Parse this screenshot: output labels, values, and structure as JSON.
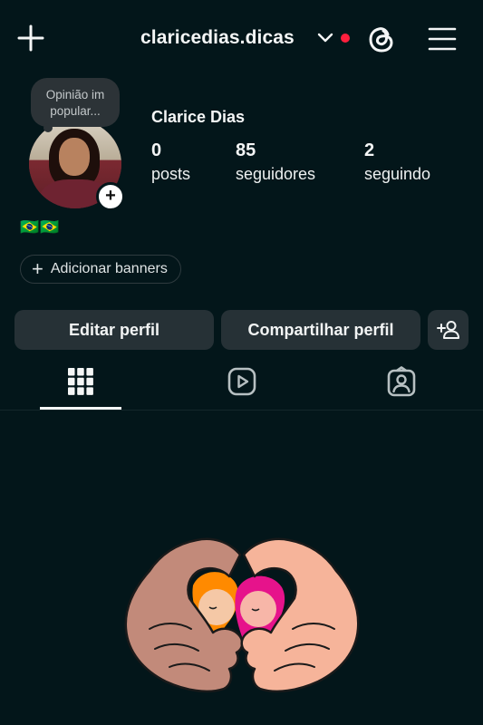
{
  "header": {
    "username": "claricedias.dicas",
    "icons": {
      "create": "plus-icon",
      "switch": "chevron-down-icon",
      "threads": "threads-icon",
      "menu": "hamburger-menu-icon"
    },
    "notification_dot_color": "#ff1f3d"
  },
  "note": {
    "text": "Opinião im popular..."
  },
  "profile": {
    "display_name": "Clarice Dias",
    "stats": [
      {
        "value": "0",
        "label": "posts"
      },
      {
        "value": "85",
        "label": "seguidores"
      },
      {
        "value": "2",
        "label": "seguindo"
      }
    ],
    "bio": "🇧🇷🇧🇷",
    "add_banner_label": "Adicionar banners",
    "add_story_symbol": "+"
  },
  "actions": {
    "edit_label": "Editar perfil",
    "share_label": "Compartilhar perfil",
    "suggest_icon": "add-person-icon"
  },
  "tabs": [
    {
      "name": "grid",
      "icon": "grid-icon",
      "active": true
    },
    {
      "name": "reels",
      "icon": "reels-icon",
      "active": false
    },
    {
      "name": "tagged",
      "icon": "tagged-person-icon",
      "active": false
    }
  ],
  "empty_state": {
    "illustration": "heart-hands-illustration"
  },
  "colors": {
    "background": "#03161a",
    "button": "#263136",
    "text": "#f4f6f6"
  }
}
